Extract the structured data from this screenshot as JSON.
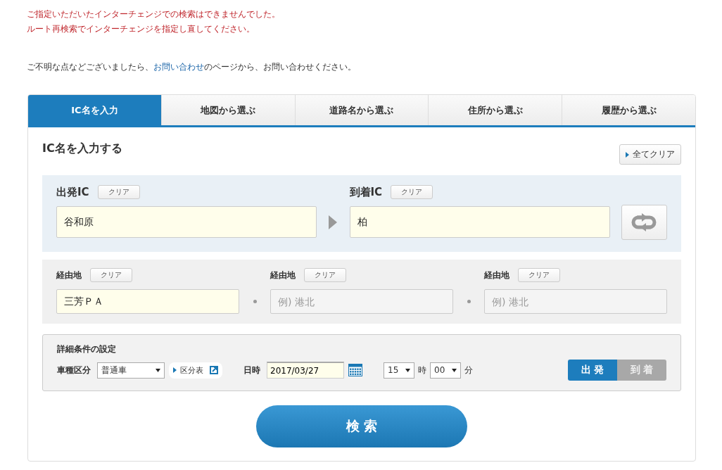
{
  "error_lines": [
    "ご指定いただいたインターチェンジでの検索はできませんでした。",
    "ルート再検索でインターチェンジを指定し直してください。"
  ],
  "notice": {
    "before": "ご不明な点などございましたら、",
    "link": "お問い合わせ",
    "after": "のページから、お問い合わせください。"
  },
  "tabs": [
    {
      "label": "IC名を入力",
      "selected": true
    },
    {
      "label": "地図から選ぶ",
      "selected": false
    },
    {
      "label": "道路名から選ぶ",
      "selected": false
    },
    {
      "label": "住所から選ぶ",
      "selected": false
    },
    {
      "label": "履歴から選ぶ",
      "selected": false
    }
  ],
  "section_title": "IC名を入力する",
  "clear_all_button": "全てクリア",
  "origin": {
    "label": "出発IC",
    "clear": "クリア",
    "value": "谷和原"
  },
  "destination": {
    "label": "到着IC",
    "clear": "クリア",
    "value": "柏"
  },
  "waypoints": [
    {
      "label": "経由地",
      "clear": "クリア",
      "value": "三芳ＰＡ"
    },
    {
      "label": "経由地",
      "clear": "クリア",
      "placeholder": "例) 港北"
    },
    {
      "label": "経由地",
      "clear": "クリア",
      "placeholder": "例) 港北"
    }
  ],
  "details": {
    "title": "詳細条件の設定",
    "vehicle_label": "車種区分",
    "vehicle_value": "普通車",
    "class_table_link": "区分表",
    "date_label": "日時",
    "date_value": "2017/03/27",
    "hour": "15",
    "hour_unit": "時",
    "minute": "00",
    "minute_unit": "分",
    "mode_toggle": [
      {
        "label": "出 発",
        "selected": true
      },
      {
        "label": "到 着",
        "selected": false
      }
    ]
  },
  "search_button": "検 索"
}
